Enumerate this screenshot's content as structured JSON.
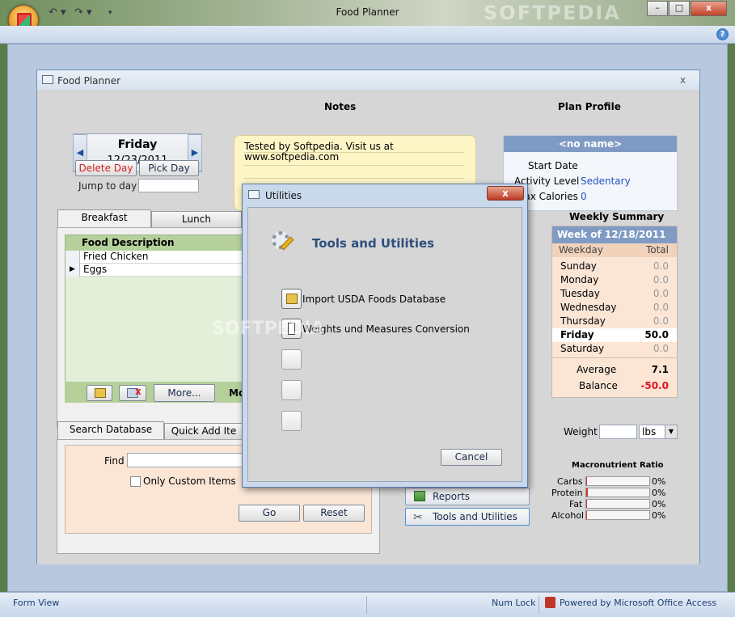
{
  "app": {
    "title": "Food Planner",
    "watermark": "SOFTPEDIA",
    "window_buttons": {
      "minimize": "–",
      "maximize": "□",
      "close": "x"
    },
    "help": "?"
  },
  "statusbar": {
    "view": "Form View",
    "numlock": "Num Lock",
    "powered": "Powered by Microsoft Office Access"
  },
  "form": {
    "title": "Food Planner",
    "close": "x",
    "day": {
      "name": "Friday",
      "date": "12/23/2011",
      "prev": "◀",
      "next": "▶"
    },
    "delete_day": "Delete Day",
    "pick_day": "Pick Day",
    "jump_label": "Jump to day",
    "jump_value": "",
    "notes": {
      "heading": "Notes",
      "text_line1": "Tested by Softpedia. Visit us at",
      "text_line2": "www.softpedia.com"
    },
    "profile": {
      "heading": "Plan Profile",
      "name": "<no name>",
      "start_date_label": "Start Date",
      "start_date_value": "",
      "activity_label": "Activity Level",
      "activity_value": "Sedentary",
      "maxcal_label": "Max Calories",
      "maxcal_value": "0"
    },
    "meal_tabs": [
      "Breakfast",
      "Lunch"
    ],
    "grid": {
      "header": "Food Description",
      "rows": [
        "Fried Chicken",
        "Eggs"
      ],
      "more": "More...",
      "mo": "Mo"
    },
    "search_tabs": [
      "Search Database",
      "Quick Add Ite"
    ],
    "search": {
      "find_label": "Find",
      "find_value": "",
      "only_custom": "Only Custom Items",
      "go": "Go",
      "reset": "Reset"
    },
    "weekly": {
      "heading": "Weekly Summary",
      "week_of": "Week of  12/18/2011",
      "col_weekday": "Weekday",
      "col_total": "Total",
      "days": [
        {
          "name": "Sunday",
          "total": "0.0"
        },
        {
          "name": "Monday",
          "total": "0.0"
        },
        {
          "name": "Tuesday",
          "total": "0.0"
        },
        {
          "name": "Wednesday",
          "total": "0.0"
        },
        {
          "name": "Thursday",
          "total": "0.0"
        },
        {
          "name": "Friday",
          "total": "50.0"
        },
        {
          "name": "Saturday",
          "total": "0.0"
        }
      ],
      "average_label": "Average",
      "average_value": "7.1",
      "balance_label": "Balance",
      "balance_value": "-50.0"
    },
    "weight": {
      "label": "Weight",
      "value": "",
      "unit": "lbs"
    },
    "macro": {
      "heading": "Macronutrient Ratio",
      "rows": [
        {
          "name": "Carbs",
          "pct": "0%"
        },
        {
          "name": "Protein",
          "pct": "0%"
        },
        {
          "name": "Fat",
          "pct": "0%"
        },
        {
          "name": "Alcohol",
          "pct": "0%"
        }
      ]
    },
    "nav": {
      "reports": "Reports",
      "tools": "Tools and Utilities"
    }
  },
  "dialog": {
    "title": "Utilities",
    "heading": "Tools and Utilities",
    "items": [
      "Import USDA Foods Database",
      "Weights und Measures Conversion"
    ],
    "cancel": "Cancel"
  },
  "colors": {
    "accent_blue": "#2353c4",
    "header_blue": "#7f9bc4",
    "balance_red": "#e0141e",
    "delete_red": "#d21f1f"
  }
}
